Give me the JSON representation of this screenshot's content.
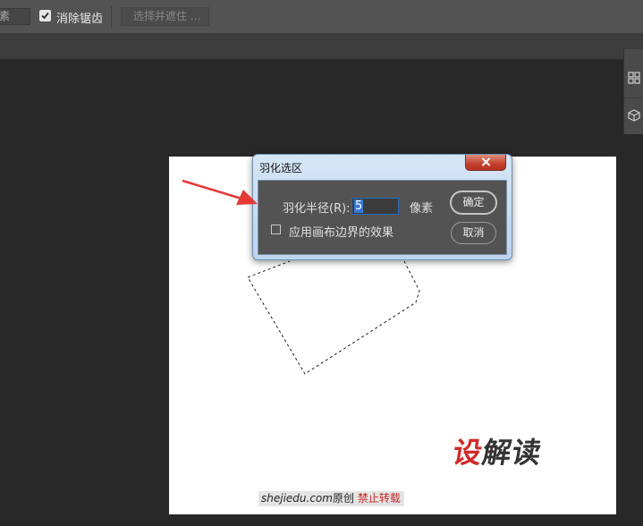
{
  "options_bar": {
    "feather_unit_fragment": "素",
    "anti_alias_label": "消除锯齿",
    "anti_alias_checked": true,
    "select_and_mask_label": "选择并遮住 ..."
  },
  "dialog": {
    "title": "羽化选区",
    "close_glyph": "✕",
    "radius_label": "羽化半径(R):",
    "radius_value": "5",
    "unit": "像素",
    "apply_edge_label": "应用画布边界的效果",
    "apply_edge_checked": false,
    "ok_label": "确定",
    "cancel_label": "取消"
  },
  "canvas": {
    "watermark_logo": {
      "part1": "设",
      "part2": "解读"
    },
    "url_strip": {
      "site": "shejiedu.com",
      "original": "原创",
      "notice": "禁止转载"
    }
  },
  "colors": {
    "annotation_arrow": "#e53935",
    "workspace": "#282828",
    "dialog_body": "#535353",
    "watermark_red": "#cf2a2a"
  },
  "icons": [
    "check-icon",
    "close-icon",
    "libraries-panel-icon",
    "3d-panel-icon",
    "annotation-arrow"
  ]
}
